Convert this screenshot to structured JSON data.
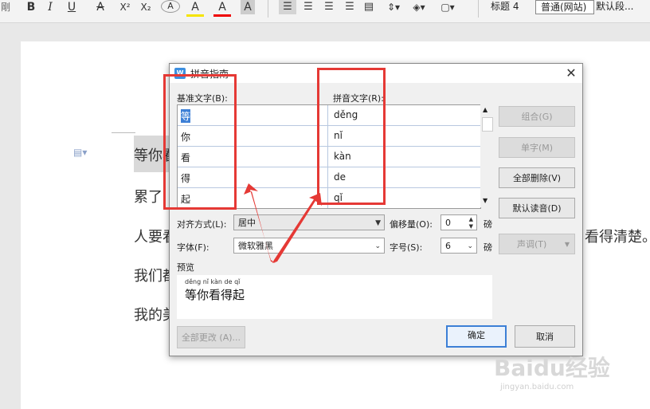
{
  "toolbar": {
    "left_glyph": "剛",
    "bold": "B",
    "italic": "I",
    "underline": "U",
    "strike": "A",
    "superscript": "X²",
    "subscript": "X₂",
    "effects": "A",
    "highlight": "A",
    "font_color": "A",
    "char_shade": "A",
    "styles": [
      "标题 4",
      "普通(网站)",
      "默认段..."
    ]
  },
  "document": {
    "lines": [
      "等你看",
      "累了,",
      "人要看",
      "我们都",
      "我的美"
    ],
    "right_text": "看得清楚。"
  },
  "dialog": {
    "title": "拼音指南",
    "close": "✕",
    "base_header": "基准文字(B):",
    "pinyin_header": "拼音文字(R):",
    "rows": [
      {
        "base": "等",
        "pinyin": "děng"
      },
      {
        "base": "你",
        "pinyin": "nǐ"
      },
      {
        "base": "看",
        "pinyin": "kàn"
      },
      {
        "base": "得",
        "pinyin": "de"
      },
      {
        "base": "起",
        "pinyin": "qǐ"
      }
    ],
    "buttons": {
      "group": "组合(G)",
      "single": "单字(M)",
      "delete_all": "全部删除(V)",
      "default_reading": "默认读音(D)",
      "tone": "声调(T)",
      "change_all": "全部更改 (A)...",
      "ok": "确定",
      "cancel": "取消"
    },
    "align_label": "对齐方式(L):",
    "align_value": "居中",
    "offset_label": "偏移量(O):",
    "offset_value": "0",
    "offset_unit": "磅",
    "font_label": "字体(F):",
    "font_value": "微软雅黑",
    "size_label": "字号(S):",
    "size_value": "6",
    "size_unit": "磅",
    "preview_label": "预览",
    "preview_pinyin": "děng nǐ kàn de qǐ",
    "preview_text": "等你看得起"
  },
  "watermark": {
    "brand": "Baidu经验",
    "url": "jingyan.baidu.com"
  },
  "colors": {
    "annotation": "#e53935",
    "accent": "#3c7fd6"
  }
}
